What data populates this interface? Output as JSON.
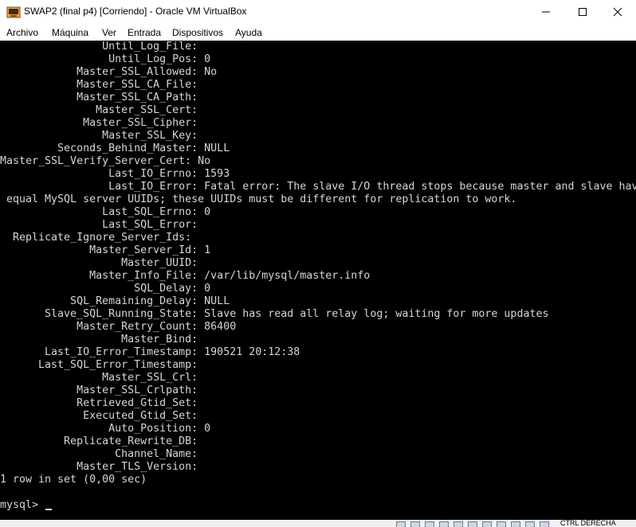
{
  "window": {
    "title": "SWAP2 (final p4) [Corriendo] - Oracle VM VirtualBox"
  },
  "menu": {
    "items": [
      "Archivo",
      "Máquina",
      "Ver",
      "Entrada",
      "Dispositivos",
      "Ayuda"
    ]
  },
  "console": {
    "lines": [
      "                Until_Log_File: ",
      "                 Until_Log_Pos: 0",
      "            Master_SSL_Allowed: No",
      "            Master_SSL_CA_File: ",
      "            Master_SSL_CA_Path: ",
      "               Master_SSL_Cert: ",
      "             Master_SSL_Cipher: ",
      "                Master_SSL_Key: ",
      "         Seconds_Behind_Master: NULL",
      "Master_SSL_Verify_Server_Cert: No",
      "                 Last_IO_Errno: 1593",
      "                 Last_IO_Error: Fatal error: The slave I/O thread stops because master and slave have",
      " equal MySQL server UUIDs; these UUIDs must be different for replication to work.",
      "                Last_SQL_Errno: 0",
      "                Last_SQL_Error: ",
      "  Replicate_Ignore_Server_Ids: ",
      "              Master_Server_Id: 1",
      "                   Master_UUID: ",
      "              Master_Info_File: /var/lib/mysql/master.info",
      "                     SQL_Delay: 0",
      "           SQL_Remaining_Delay: NULL",
      "       Slave_SQL_Running_State: Slave has read all relay log; waiting for more updates",
      "            Master_Retry_Count: 86400",
      "                   Master_Bind: ",
      "       Last_IO_Error_Timestamp: 190521 20:12:38",
      "      Last_SQL_Error_Timestamp: ",
      "                Master_SSL_Crl: ",
      "            Master_SSL_Crlpath: ",
      "            Retrieved_Gtid_Set: ",
      "             Executed_Gtid_Set: ",
      "                 Auto_Position: 0",
      "          Replicate_Rewrite_DB: ",
      "                  Channel_Name: ",
      "            Master_TLS_Version: ",
      "1 row in set (0,00 sec)",
      "",
      "mysql> "
    ]
  },
  "statusbar": {
    "host_key": "CTRL DERECHA"
  },
  "colors": {
    "console_bg": "#000000",
    "console_fg": "#d6d6d6"
  }
}
